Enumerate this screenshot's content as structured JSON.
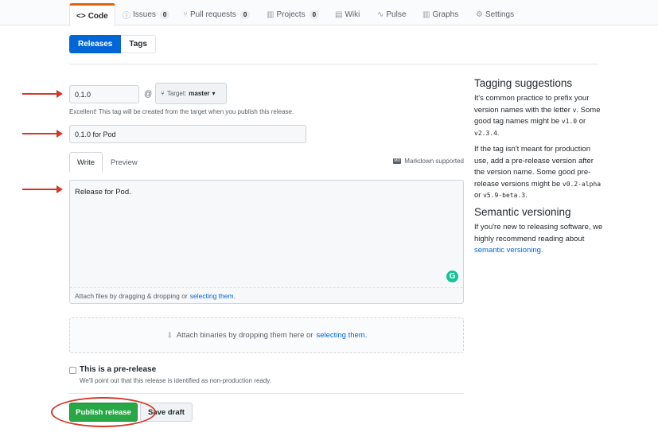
{
  "repo_nav": {
    "tabs": [
      {
        "icon": "code-icon",
        "glyph": "<>",
        "label": "Code",
        "selected": true
      },
      {
        "icon": "issue-icon",
        "glyph": "ⓘ",
        "label": "Issues",
        "count": "0"
      },
      {
        "icon": "pull-request-icon",
        "glyph": "⑂",
        "label": "Pull requests",
        "count": "0"
      },
      {
        "icon": "projects-icon",
        "glyph": "▥",
        "label": "Projects",
        "count": "0"
      },
      {
        "icon": "wiki-icon",
        "glyph": "▤",
        "label": "Wiki"
      },
      {
        "icon": "pulse-icon",
        "glyph": "∿",
        "label": "Pulse"
      },
      {
        "icon": "graph-icon",
        "glyph": "▥",
        "label": "Graphs"
      },
      {
        "icon": "gear-icon",
        "glyph": "⚙",
        "label": "Settings"
      }
    ]
  },
  "subnav": {
    "releases": "Releases",
    "tags": "Tags"
  },
  "form": {
    "tag_value": "0.1.0",
    "at_symbol": "@",
    "target_label": "Target:",
    "target_branch": "master",
    "tag_note": "Excellent! This tag will be created from the target when you publish this release.",
    "title_value": "0.1.0 for Pod",
    "tab_write": "Write",
    "tab_preview": "Preview",
    "markdown_supported": "Markdown supported",
    "markdown_icon_text": "MD",
    "body_text": "Release for Pod.",
    "attach_prefix": "Attach files by dragging & dropping or",
    "attach_link": "selecting them.",
    "grammarly_letter": "G",
    "binaries_prefix": "Attach binaries by dropping them here or",
    "binaries_link": "selecting them.",
    "prerelease_label": "This is a pre-release",
    "prerelease_note": "We'll point out that this release is identified as non-production ready.",
    "publish_button": "Publish release",
    "draft_button": "Save draft"
  },
  "sidebar": {
    "tagging_title": "Tagging suggestions",
    "tagging_p1": "It's common practice to prefix your version names with the letter",
    "tagging_p1_code": "v",
    "tagging_p1b": ". Some good tag names might be",
    "tagging_code1": "v1.0",
    "tagging_or": "or",
    "tagging_code2": "v2.3.4",
    "tagging_p2": "If the tag isn't meant for production use, add a pre-release version after the version name. Some good pre-release versions might be",
    "tagging_code3": "v0.2-alpha",
    "tagging_code4": "v5.9-beta.3",
    "semver_title": "Semantic versioning",
    "semver_p": "If you're new to releasing software, we highly recommend reading about",
    "semver_link": "semantic versioning."
  },
  "colors": {
    "accent": "#0366d6",
    "publish": "#28a745",
    "annotation": "#d03a2a"
  }
}
